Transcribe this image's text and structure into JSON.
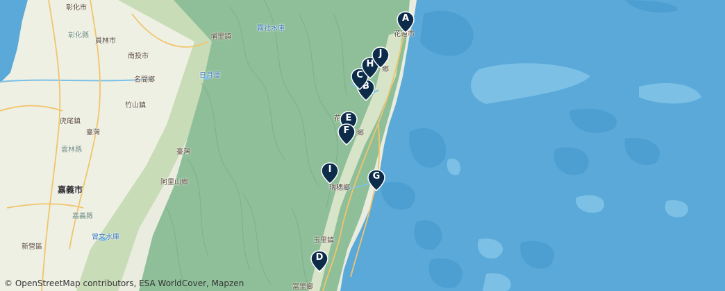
{
  "map": {
    "colors": {
      "sea": "#5aa9d8",
      "deep_sea": "#4d9fd2",
      "shallow": "#7cc0e6",
      "mountains": "#8fbf98",
      "lowland": "#d8e4c8",
      "plain": "#e9ecdf",
      "road": "#f2c46b",
      "marker": "#0d2c49"
    },
    "place_labels": [
      {
        "id": "changhua",
        "text": "彰化市",
        "cls": ""
      },
      {
        "id": "changhua2",
        "text": "彰化縣",
        "cls": "muted"
      },
      {
        "id": "yuanlin",
        "text": "員林市",
        "cls": ""
      },
      {
        "id": "nantou",
        "text": "南投市",
        "cls": ""
      },
      {
        "id": "mingjian",
        "text": "名間鄉",
        "cls": ""
      },
      {
        "id": "zhushan",
        "text": "竹山鎮",
        "cls": ""
      },
      {
        "id": "huwei",
        "text": "虎尾鎮",
        "cls": ""
      },
      {
        "id": "taiwan1",
        "text": "臺灣",
        "cls": ""
      },
      {
        "id": "yunlin",
        "text": "雲林縣",
        "cls": "muted"
      },
      {
        "id": "chiayi",
        "text": "嘉義市",
        "cls": "city"
      },
      {
        "id": "chiayi2",
        "text": "嘉義縣",
        "cls": "muted"
      },
      {
        "id": "xinying",
        "text": "新營區",
        "cls": ""
      },
      {
        "id": "alishan",
        "text": "阿里山鄉",
        "cls": ""
      },
      {
        "id": "taiwan2",
        "text": "臺灣",
        "cls": ""
      },
      {
        "id": "puli",
        "text": "埔里鎮",
        "cls": ""
      },
      {
        "id": "wushe",
        "text": "霧社水庫",
        "cls": "water"
      },
      {
        "id": "sunmoon",
        "text": "日月潭",
        "cls": "water"
      },
      {
        "id": "zengwen",
        "text": "曾文水庫",
        "cls": "water"
      },
      {
        "id": "hualien",
        "text": "花蓮市",
        "cls": ""
      },
      {
        "id": "ruisui",
        "text": "瑞穗鄉",
        "cls": ""
      },
      {
        "id": "yuli",
        "text": "玉里鎮",
        "cls": ""
      },
      {
        "id": "fuli",
        "text": "富里鄉",
        "cls": ""
      },
      {
        "id": "fenglin",
        "text": "鄉",
        "cls": ""
      },
      {
        "id": "shoufeng",
        "text": "鄉",
        "cls": ""
      },
      {
        "id": "hualien2",
        "text": "花",
        "cls": ""
      }
    ],
    "markers": [
      {
        "letter": "A",
        "name": "marker-a"
      },
      {
        "letter": "B",
        "name": "marker-b"
      },
      {
        "letter": "C",
        "name": "marker-c"
      },
      {
        "letter": "D",
        "name": "marker-d"
      },
      {
        "letter": "E",
        "name": "marker-e"
      },
      {
        "letter": "F",
        "name": "marker-f"
      },
      {
        "letter": "G",
        "name": "marker-g"
      },
      {
        "letter": "H",
        "name": "marker-h"
      },
      {
        "letter": "I",
        "name": "marker-i"
      },
      {
        "letter": "J",
        "name": "marker-j"
      }
    ],
    "attribution": {
      "symbol": "©",
      "text": "OpenStreetMap contributors, ESA WorldCover, Mapzen"
    }
  }
}
